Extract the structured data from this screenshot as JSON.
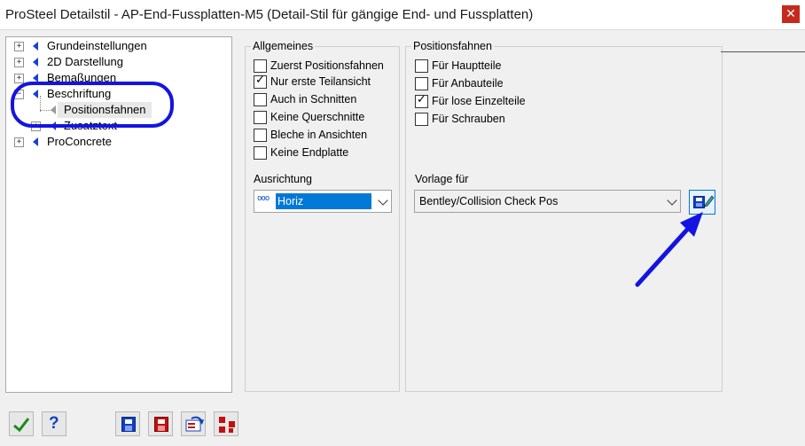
{
  "window": {
    "title": "ProSteel Detailstil - AP-End-Fussplatten-M5 (Detail-Stil für gängige End- und Fussplatten)",
    "close_glyph": "✕"
  },
  "tree": {
    "items": [
      {
        "label": "Grundeinstellungen",
        "expander": "+"
      },
      {
        "label": "2D Darstellung",
        "expander": "+"
      },
      {
        "label": "Bemaßungen",
        "expander": "+"
      },
      {
        "label": "Beschriftung",
        "expander": "−"
      },
      {
        "label": "Positionsfahnen",
        "selected": true
      },
      {
        "label": "Zusatztext",
        "expander": "+"
      },
      {
        "label": "ProConcrete",
        "expander": "+"
      }
    ]
  },
  "allgemeines": {
    "title": "Allgemeines",
    "checkboxes": [
      {
        "label": "Zuerst Positionsfahnen",
        "checked": false
      },
      {
        "label": "Nur erste Teilansicht",
        "checked": true
      },
      {
        "label": "Auch in Schnitten",
        "checked": false
      },
      {
        "label": "Keine Querschnitte",
        "checked": false
      },
      {
        "label": "Bleche in Ansichten",
        "checked": false
      },
      {
        "label": "Keine Endplatte",
        "checked": false
      }
    ],
    "ausrichtung_label": "Ausrichtung",
    "ausrichtung_value": "Horiz",
    "ausrichtung_icon": "ooo"
  },
  "positionsfahnen": {
    "title": "Positionsfahnen",
    "checkboxes": [
      {
        "label": "Für Hauptteile",
        "checked": false
      },
      {
        "label": "Für Anbauteile",
        "checked": false
      },
      {
        "label": "Für lose Einzelteile",
        "checked": true
      },
      {
        "label": "Für Schrauben",
        "checked": false
      }
    ],
    "vorlage_label": "Vorlage für",
    "vorlage_value": "Bentley/Collision Check Pos"
  },
  "checkmark_glyph": "✓",
  "toolbar": {
    "help_glyph": "?"
  },
  "colors": {
    "accent": "#0078d7",
    "annotation": "#1414e0",
    "close": "#c42b1c"
  }
}
